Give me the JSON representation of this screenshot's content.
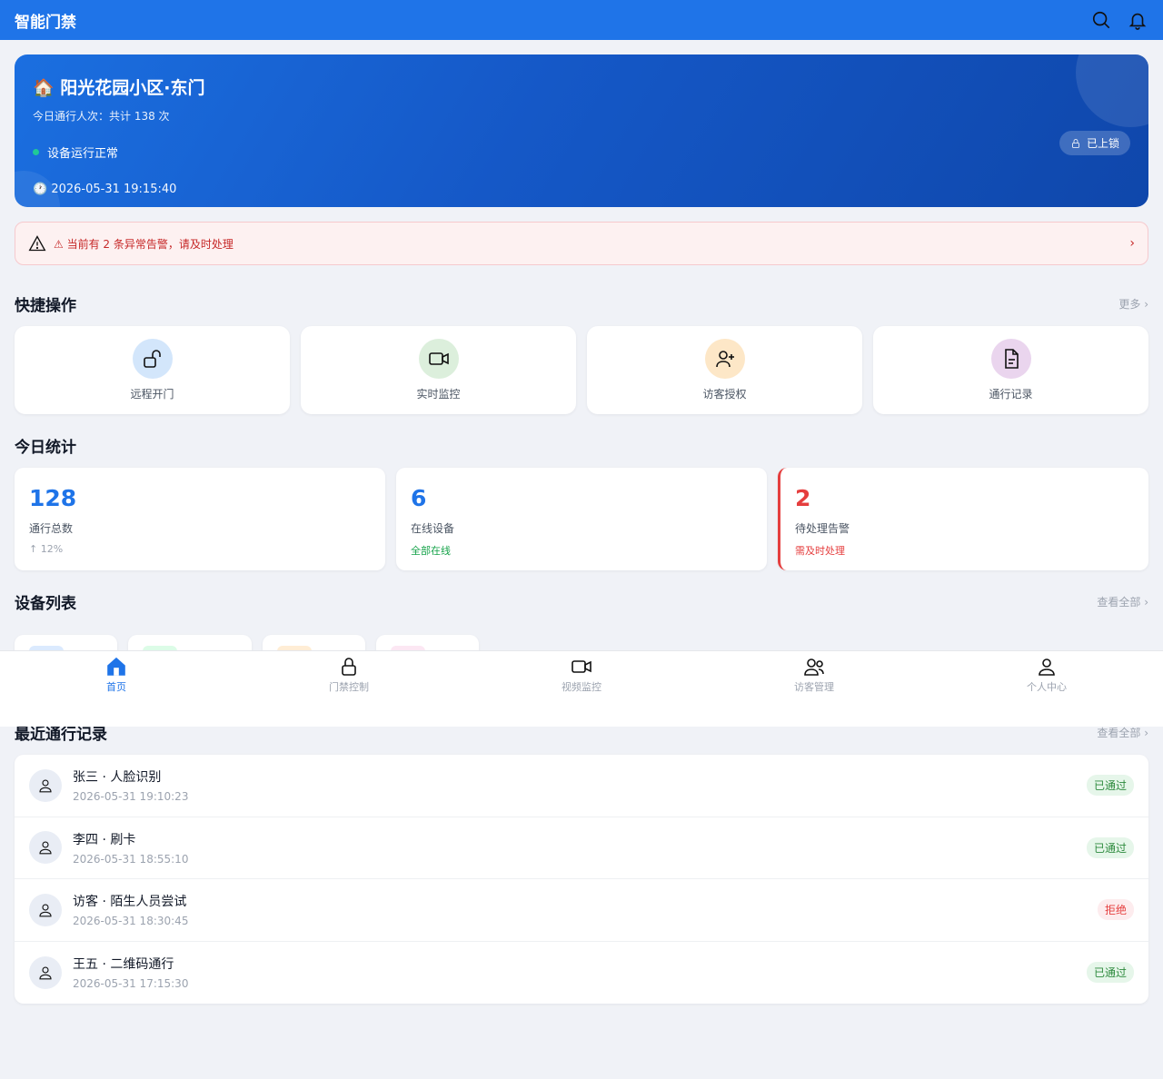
{
  "header": {
    "title": "智能门禁",
    "search_icon": "search-icon",
    "bell_icon": "bell-icon"
  },
  "hero": {
    "title": "🏠 阳光花园小区·东门",
    "subtitle": "今日通行人次：共计 138 次",
    "status": "设备运行正常",
    "time": "🕐 2026-05-31 19:15:40",
    "lock_label": "已上锁"
  },
  "alert": {
    "text": "⚠ 当前有 2 条异常告警，请及时处理",
    "chevron": "›"
  },
  "quick_actions": {
    "title": "快捷操作",
    "more": "更多 ›",
    "items": [
      {
        "label": "远程开门",
        "icon": "unlock-icon",
        "color": "#d3e6fb"
      },
      {
        "label": "实时监控",
        "icon": "video-icon",
        "color": "#dcefdc"
      },
      {
        "label": "访客授权",
        "icon": "user-plus-icon",
        "color": "#fde7c7"
      },
      {
        "label": "通行记录",
        "icon": "document-icon",
        "color": "#ead5ee"
      }
    ]
  },
  "stats": {
    "title": "今日统计",
    "items": [
      {
        "value": "128",
        "label": "通行总数",
        "sub": "↑ 12%"
      },
      {
        "value": "6",
        "label": "在线设备",
        "sub": "全部在线"
      },
      {
        "value": "2",
        "label": "待处理告警",
        "sub": "需及时处理"
      }
    ]
  },
  "devices": {
    "title": "设备列表",
    "more": "查看全部 ›"
  },
  "tabbar": [
    {
      "label": "首页",
      "icon": "home-icon",
      "active": true
    },
    {
      "label": "门禁控制",
      "icon": "lock-icon"
    },
    {
      "label": "视频监控",
      "icon": "video-icon"
    },
    {
      "label": "访客管理",
      "icon": "users-icon"
    },
    {
      "label": "个人中心",
      "icon": "user-icon"
    }
  ],
  "records": {
    "title": "最近通行记录",
    "more": "查看全部 ›",
    "items": [
      {
        "name": "张三 · 人脸识别",
        "time": "2026-05-31 19:10:23",
        "status": "已通过",
        "ok": true
      },
      {
        "name": "李四 · 刷卡",
        "time": "2026-05-31 18:55:10",
        "status": "已通过",
        "ok": true
      },
      {
        "name": "访客 · 陌生人员尝试",
        "time": "2026-05-31 18:30:45",
        "status": "拒绝",
        "ok": false
      },
      {
        "name": "王五 · 二维码通行",
        "time": "2026-05-31 17:15:30",
        "status": "已通过",
        "ok": true
      }
    ]
  }
}
